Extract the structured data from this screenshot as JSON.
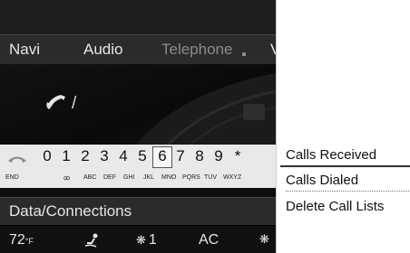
{
  "nav": {
    "items": [
      "Navi",
      "Audio",
      "Telephone",
      "V"
    ]
  },
  "dial": {
    "cursor": "/"
  },
  "keypad": {
    "end_label": "END",
    "keys": [
      "0",
      "1",
      "2",
      "3",
      "4",
      "5",
      "6",
      "7",
      "8",
      "9",
      "*"
    ],
    "selected": "6",
    "sub_labels": [
      "ꝏ",
      "ABC",
      "DEF",
      "GHI",
      "JKL",
      "MNO",
      "PQRS",
      "TUV",
      "WXYZ"
    ]
  },
  "data_connections": {
    "label": "Data/Connections"
  },
  "climate": {
    "temperature": "72",
    "temp_unit": "°F",
    "fan_symbol": "❋",
    "fan_level": "1",
    "ac": "AC"
  },
  "menu": {
    "items": [
      "Calls Received",
      "Calls Dialed",
      "Delete Call Lists"
    ]
  }
}
